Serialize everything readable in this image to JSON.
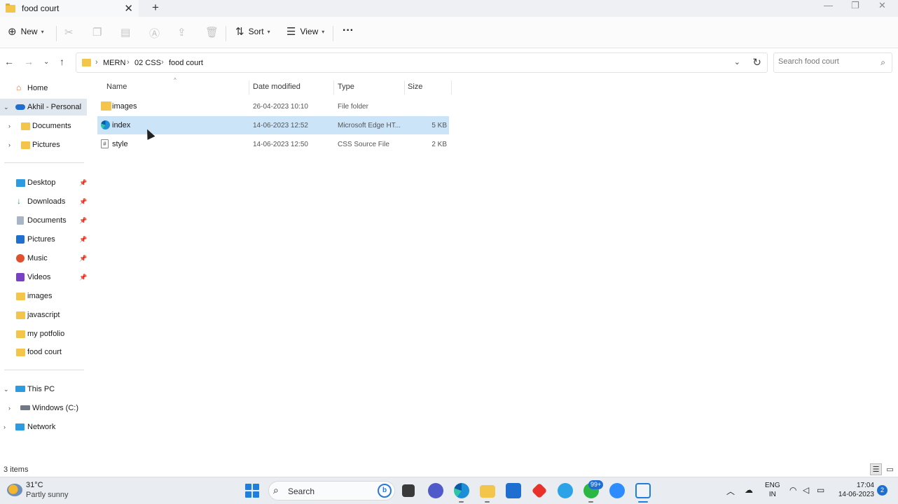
{
  "window": {
    "tab_title": "food court",
    "new_tab_symbol": "+"
  },
  "toolbar": {
    "new_label": "New",
    "sort_label": "Sort",
    "view_label": "View",
    "more_label": "···"
  },
  "address": {
    "crumbs": [
      "MERN",
      "02 CSS",
      "food court"
    ],
    "search_placeholder": "Search food court"
  },
  "sidebar": {
    "home": "Home",
    "onedrive": "Akhil - Personal",
    "onedrive_children": [
      "Documents",
      "Pictures"
    ],
    "quick_access": [
      {
        "label": "Desktop",
        "icon": "desktop-icon",
        "pinned": true
      },
      {
        "label": "Downloads",
        "icon": "download-icon",
        "pinned": true
      },
      {
        "label": "Documents",
        "icon": "documents-icon",
        "pinned": true
      },
      {
        "label": "Pictures",
        "icon": "pictures-icon",
        "pinned": true
      },
      {
        "label": "Music",
        "icon": "music-icon",
        "pinned": true
      },
      {
        "label": "Videos",
        "icon": "videos-icon",
        "pinned": true
      },
      {
        "label": "images",
        "icon": "folder-icon",
        "pinned": false
      },
      {
        "label": "javascript",
        "icon": "folder-icon",
        "pinned": false
      },
      {
        "label": "my potfolio",
        "icon": "folder-icon",
        "pinned": false
      },
      {
        "label": "food court",
        "icon": "folder-icon",
        "pinned": false
      }
    ],
    "this_pc": "This PC",
    "drive_c": "Windows (C:)",
    "network": "Network"
  },
  "columns": {
    "name": "Name",
    "date": "Date modified",
    "type": "Type",
    "size": "Size"
  },
  "files": [
    {
      "name": "images",
      "date": "26-04-2023 10:10",
      "type": "File folder",
      "size": "",
      "icon": "folder-icon",
      "selected": false
    },
    {
      "name": "index",
      "date": "14-06-2023 12:52",
      "type": "Microsoft Edge HT...",
      "size": "5 KB",
      "icon": "edge-html-icon",
      "selected": true
    },
    {
      "name": "style",
      "date": "14-06-2023 12:50",
      "type": "CSS Source File",
      "size": "2 KB",
      "icon": "css-file-icon",
      "selected": false
    }
  ],
  "status": {
    "item_count": "3 items"
  },
  "taskbar": {
    "temperature": "31°C",
    "weather": "Partly sunny",
    "search_label": "Search",
    "badge": "99+",
    "lang_top": "ENG",
    "lang_bottom": "IN",
    "time": "17:04",
    "date": "14-06-2023",
    "notifications": "2"
  },
  "colors": {
    "accent": "#1e7fdc",
    "selection": "#cce4f7",
    "folder": "#f3c64b"
  }
}
